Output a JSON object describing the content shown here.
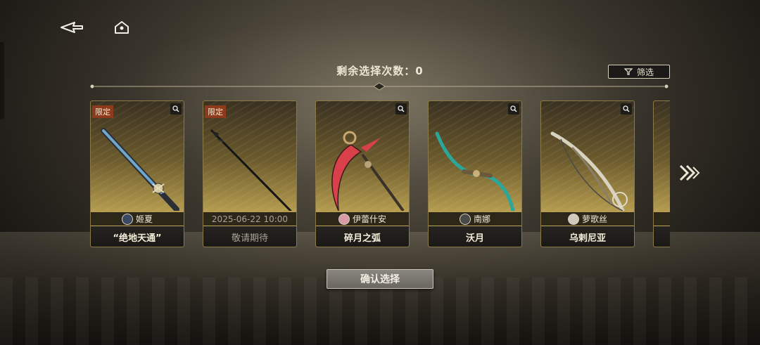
{
  "header": {
    "back_icon": "back-arrow-icon",
    "home_icon": "home-icon"
  },
  "selection": {
    "remaining_label": "剩余选择次数：0",
    "filter_label": "筛选",
    "filter_icon": "filter-icon"
  },
  "cards": [
    {
      "tag": "限定",
      "owner": "姬夏",
      "name": "“绝地天通”",
      "blade_color": "#6fa6c9"
    },
    {
      "tag": "限定",
      "date": "2025-06-22 10:00",
      "name": "敬请期待",
      "blade_color": "#151515"
    },
    {
      "tag": "",
      "owner": "伊蕾什安",
      "name": "碎月之弧",
      "blade_color": "#d9404a"
    },
    {
      "tag": "",
      "owner": "南娜",
      "name": "沃月",
      "blade_color": "#2aa79a"
    },
    {
      "tag": "",
      "owner": "萝歌丝",
      "name": "乌剌尼亚",
      "blade_color": "#d8d2c0"
    }
  ],
  "actions": {
    "confirm_label": "确认选择",
    "next_icon": "chevron-double-right-icon"
  },
  "colors": {
    "accent_gold": "#c9b265",
    "limited_tag": "#8e3a1c"
  }
}
